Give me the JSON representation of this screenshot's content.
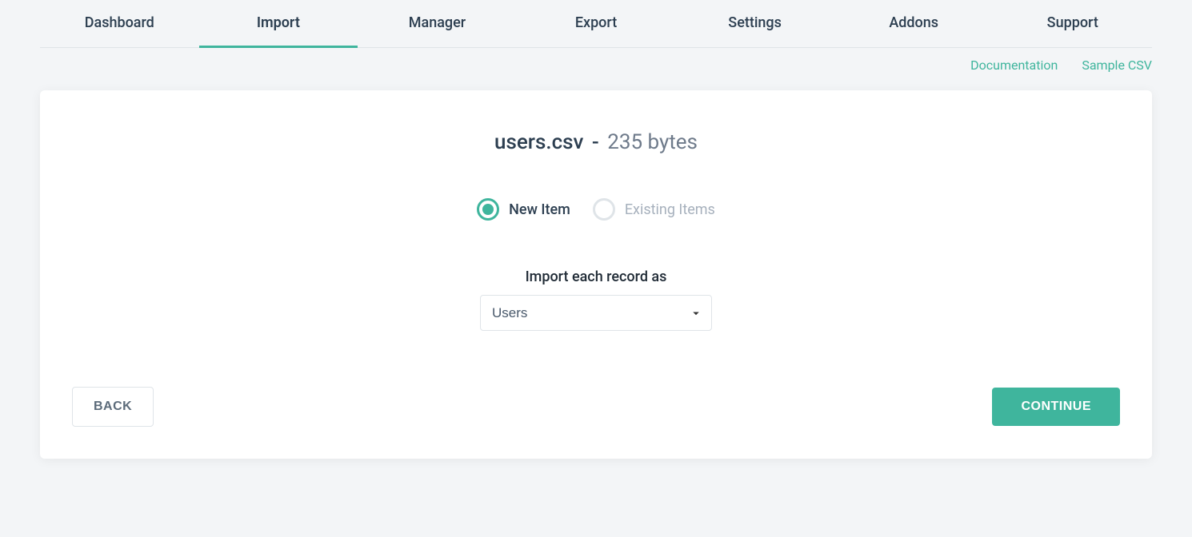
{
  "nav": {
    "tabs": [
      {
        "label": "Dashboard"
      },
      {
        "label": "Import"
      },
      {
        "label": "Manager"
      },
      {
        "label": "Export"
      },
      {
        "label": "Settings"
      },
      {
        "label": "Addons"
      },
      {
        "label": "Support"
      }
    ]
  },
  "sublinks": {
    "documentation": "Documentation",
    "sample_csv": "Sample CSV"
  },
  "file": {
    "name": "users.csv",
    "separator": "-",
    "size": "235 bytes"
  },
  "radios": {
    "new_item": "New Item",
    "existing_items": "Existing Items"
  },
  "form": {
    "import_label": "Import each record as",
    "select_value": "Users"
  },
  "buttons": {
    "back": "BACK",
    "continue": "CONTINUE"
  }
}
